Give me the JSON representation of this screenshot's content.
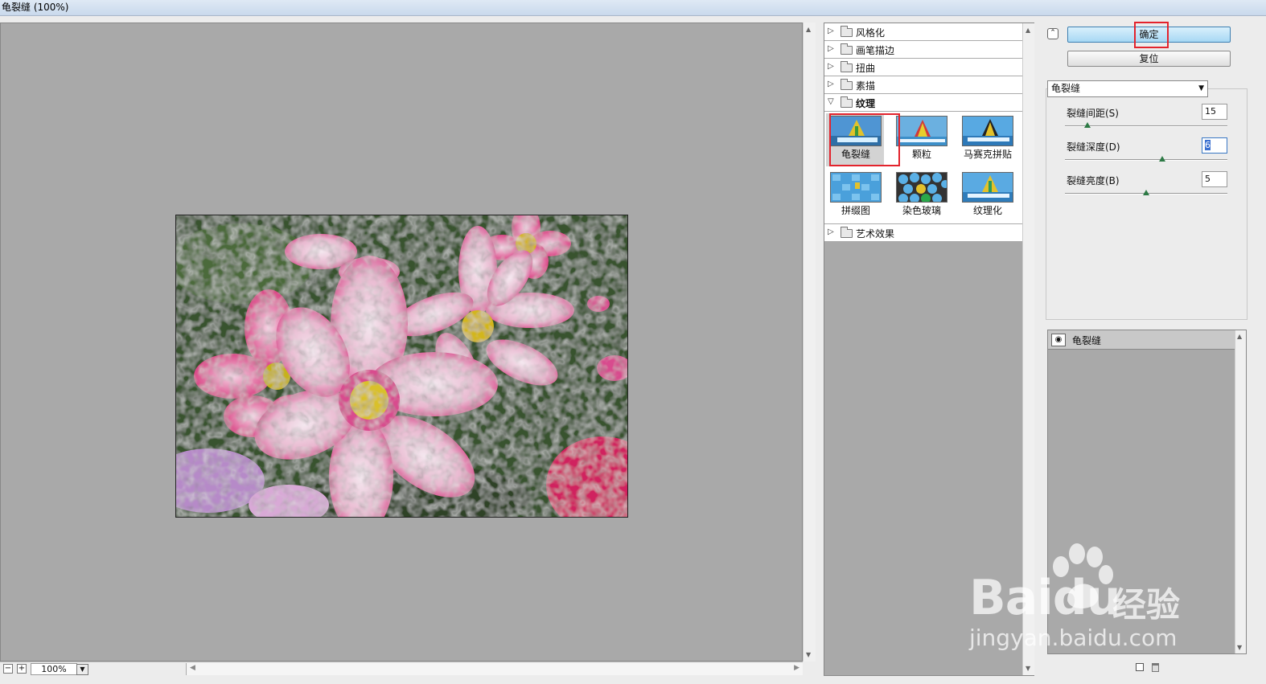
{
  "window": {
    "title": "龟裂缝 (100%)"
  },
  "preview": {
    "zoom": "100%",
    "zoom_out_symbol": "−",
    "zoom_in_symbol": "+"
  },
  "gallery": {
    "categories_top": [
      {
        "label": "风格化"
      },
      {
        "label": "画笔描边"
      },
      {
        "label": "扭曲"
      },
      {
        "label": "素描"
      }
    ],
    "open_category": {
      "label": "纹理"
    },
    "thumbnails": [
      {
        "label": "龟裂缝",
        "selected": true
      },
      {
        "label": "颗粒"
      },
      {
        "label": "马赛克拼贴"
      },
      {
        "label": "拼缀图"
      },
      {
        "label": "染色玻璃"
      },
      {
        "label": "纹理化"
      }
    ],
    "categories_bottom": [
      {
        "label": "艺术效果"
      }
    ]
  },
  "panel": {
    "ok_label": "确定",
    "reset_label": "复位",
    "filter_select": "龟裂缝",
    "params": [
      {
        "label": "裂缝间距(S)",
        "value": "15",
        "fraction": 0.14
      },
      {
        "label": "裂缝深度(D)",
        "value": "6",
        "fraction": 0.6,
        "focused": true
      },
      {
        "label": "裂缝亮度(B)",
        "value": "5",
        "fraction": 0.5
      }
    ],
    "layers": [
      {
        "label": "龟裂缝"
      }
    ]
  },
  "watermark": {
    "brand": "Bai",
    "brand_tail": "du",
    "brand_cn": "经验",
    "url": "jingyan.baidu.com"
  },
  "colors": {
    "highlight_red": "#e3232c",
    "ok_button": "#a7d8f4",
    "canvas_gray": "#a9a9a9"
  }
}
